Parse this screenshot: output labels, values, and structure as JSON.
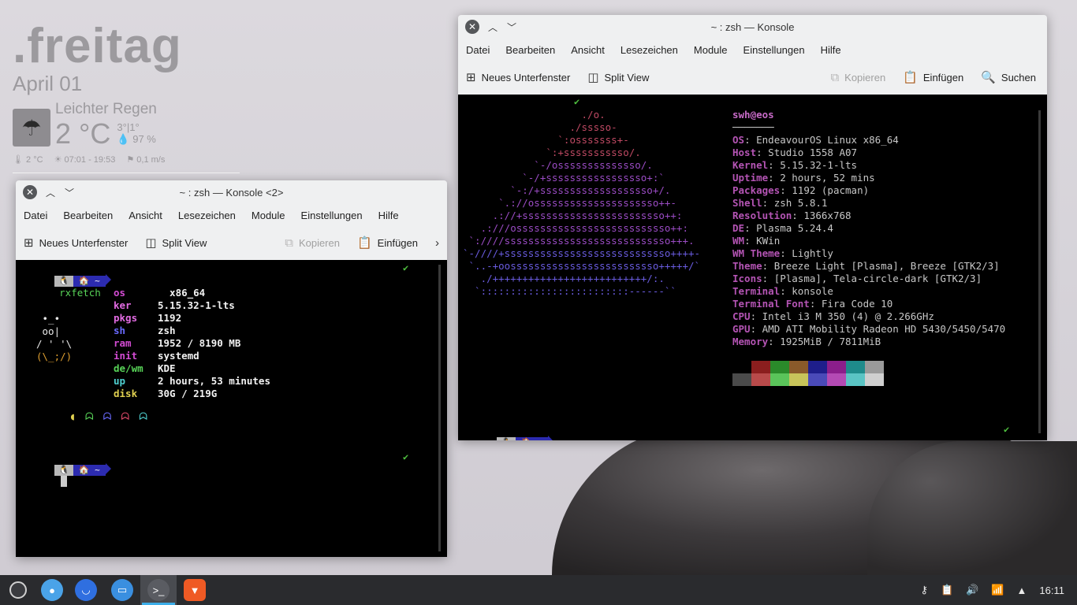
{
  "widget": {
    "day": ".freitag",
    "date": "April 01",
    "condition": "Leichter Regen",
    "temp": "2 °C",
    "minmax": "3°|1°",
    "humidity": "97 %",
    "feels": "2 °C",
    "sun": "07:01 - 19:53",
    "wind": "0,1 m/s"
  },
  "konsole_left": {
    "title": "~ : zsh — Konsole <2>",
    "menu": [
      "Datei",
      "Bearbeiten",
      "Ansicht",
      "Lesezeichen",
      "Module",
      "Einstellungen",
      "Hilfe"
    ],
    "toolbar": {
      "new_tab": "Neues Unterfenster",
      "split": "Split View",
      "copy": "Kopieren",
      "paste": "Einfügen"
    },
    "prompt_tux": "🐧",
    "prompt_home": "🏠 ~",
    "command": "rxfetch",
    "rx": [
      {
        "k": "os",
        "v": "  x86_64",
        "c": "k-magenta"
      },
      {
        "k": "ker",
        "v": "5.15.32-1-lts",
        "c": "k-pink"
      },
      {
        "k": "pkgs",
        "v": "1192",
        "c": "k-pink"
      },
      {
        "k": "sh",
        "v": "zsh",
        "c": "k-blue"
      },
      {
        "k": "ram",
        "v": "1952 / 8190 MB",
        "c": "k-magenta"
      },
      {
        "k": "init",
        "v": "systemd",
        "c": "k-magenta"
      },
      {
        "k": "de/wm",
        "v": "KDE",
        "c": "k-green"
      },
      {
        "k": "up",
        "v": "2 hours, 53 minutes",
        "c": "k-cyan"
      },
      {
        "k": "disk",
        "v": "30G / 219G",
        "c": "k-yellow"
      }
    ],
    "tux_art": [
      " •_•",
      " oo|",
      "/ ' '\\",
      "(\\_;/)"
    ]
  },
  "konsole_right": {
    "title": "~ : zsh — Konsole",
    "menu": [
      "Datei",
      "Bearbeiten",
      "Ansicht",
      "Lesezeichen",
      "Module",
      "Einstellungen",
      "Hilfe"
    ],
    "toolbar": {
      "new_tab": "Neues Unterfenster",
      "split": "Split View",
      "copy": "Kopieren",
      "paste": "Einfügen",
      "search": "Suchen"
    },
    "user": "swh@eos",
    "divider": "───────",
    "info": [
      {
        "k": "OS",
        "v": "EndeavourOS Linux x86_64"
      },
      {
        "k": "Host",
        "v": "Studio 1558 A07"
      },
      {
        "k": "Kernel",
        "v": "5.15.32-1-lts"
      },
      {
        "k": "Uptime",
        "v": "2 hours, 52 mins"
      },
      {
        "k": "Packages",
        "v": "1192 (pacman)"
      },
      {
        "k": "Shell",
        "v": "zsh 5.8.1"
      },
      {
        "k": "Resolution",
        "v": "1366x768"
      },
      {
        "k": "DE",
        "v": "Plasma 5.24.4"
      },
      {
        "k": "WM",
        "v": "KWin"
      },
      {
        "k": "WM Theme",
        "v": "Lightly"
      },
      {
        "k": "Theme",
        "v": "Breeze Light [Plasma], Breeze [GTK2/3]"
      },
      {
        "k": "Icons",
        "v": "[Plasma], Tela-circle-dark [GTK2/3]"
      },
      {
        "k": "Terminal",
        "v": "konsole"
      },
      {
        "k": "Terminal Font",
        "v": "Fira Code 10"
      },
      {
        "k": "CPU",
        "v": "Intel i3 M 350 (4) @ 2.266GHz"
      },
      {
        "k": "GPU",
        "v": "AMD ATI Mobility Radeon HD 5430/5450/5470"
      },
      {
        "k": "Memory",
        "v": "1925MiB / 7811MiB"
      }
    ],
    "art": [
      "                    ./o.",
      "                  ./sssso-",
      "                `:osssssss+-",
      "              `:+sssssssssso/.",
      "            `-/ossssssssssssso/.",
      "          `-/+sssssssssssssssso+:`",
      "        `-:/+sssssssssssssssssso+/.",
      "      `.://osssssssssssssssssssso++-",
      "     .://+ssssssssssssssssssssssso++:",
      "   .:///ossssssssssssssssssssssssso++:",
      " `:////ssssssssssssssssssssssssssso+++.",
      "`-////+ssssssssssssssssssssssssssso++++-",
      " `..-+oosssssssssssssssssssssssso+++++/`",
      "   ./++++++++++++++++++++++++++/:.",
      "  `:::::::::::::::::::::::::------``"
    ],
    "palette_top": [
      "#000000",
      "#8b1e1e",
      "#2a8a2a",
      "#8a5a2a",
      "#1e1e8b",
      "#8b1e8b",
      "#1e8b8b",
      "#9a9a9a"
    ],
    "palette_bottom": [
      "#4a4a4a",
      "#b84a4a",
      "#5ac45a",
      "#c8c45a",
      "#4a4ab8",
      "#b44ab4",
      "#5ac4c4",
      "#cfcfcf"
    ]
  },
  "taskbar": {
    "clock": "16:11"
  }
}
